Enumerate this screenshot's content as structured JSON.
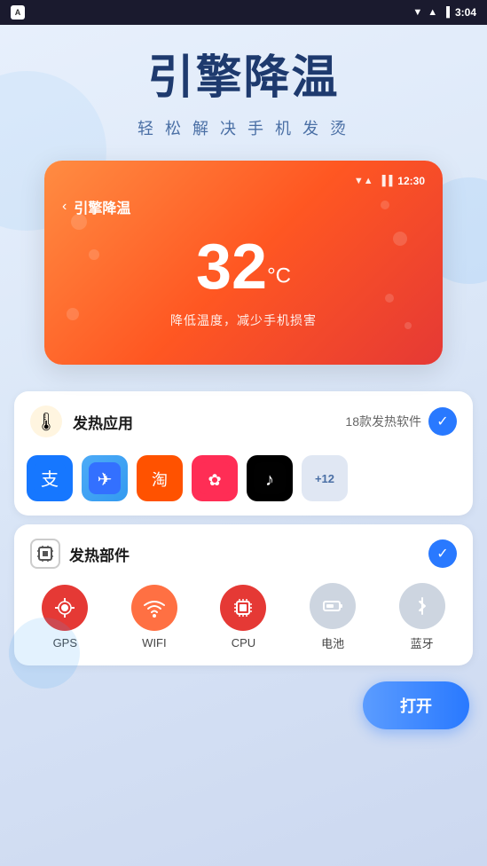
{
  "statusBar": {
    "appLabel": "A",
    "time": "3:04",
    "icons": [
      "▼",
      "▲",
      "📶",
      "🔋"
    ]
  },
  "hero": {
    "title": "引擎降温",
    "subtitle": "轻 松 解 决 手 机 发 烫"
  },
  "phoneScreen": {
    "time": "12:30",
    "navBack": "‹",
    "navTitle": "引擎降温",
    "temperature": "32",
    "tempUnit": "°C",
    "description": "降低温度，减少手机损害"
  },
  "hotApps": {
    "icon": "🌡",
    "label": "发热应用",
    "count": "18款发热软件",
    "apps": [
      {
        "name": "支付宝",
        "emoji": "支",
        "type": "alipay"
      },
      {
        "name": "飞书",
        "emoji": "✈",
        "type": "feishu"
      },
      {
        "name": "淘宝",
        "emoji": "淘",
        "type": "taobao"
      },
      {
        "name": "小红书",
        "emoji": "✿",
        "type": "xiaohongshu"
      },
      {
        "name": "抖音",
        "emoji": "♪",
        "type": "tiktok"
      },
      {
        "name": "+12",
        "emoji": "+12",
        "type": "more"
      }
    ]
  },
  "hotComponents": {
    "icon": "⚙",
    "label": "发热部件",
    "components": [
      {
        "name": "GPS",
        "emoji": "◎",
        "type": "active-red"
      },
      {
        "name": "WIFI",
        "emoji": "((·))",
        "type": "active-orange"
      },
      {
        "name": "CPU",
        "emoji": "▣",
        "type": "active-deep-red"
      },
      {
        "name": "电池",
        "emoji": "▭",
        "type": "inactive"
      },
      {
        "name": "蓝牙",
        "emoji": "ᛒ",
        "type": "inactive"
      }
    ]
  },
  "openButton": {
    "label": "打开"
  }
}
